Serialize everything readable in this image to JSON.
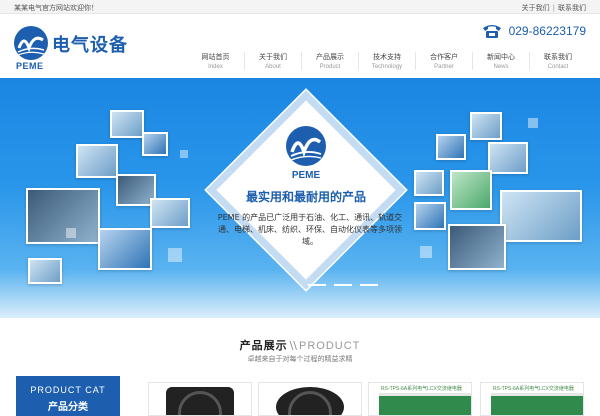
{
  "topbar": {
    "welcome": "某某电气官方网站欢迎你！",
    "links": [
      "关于我们",
      "联系我们"
    ]
  },
  "brand": {
    "name_cn": "电气设备",
    "name_en": "PEME",
    "color": "#1d5fae"
  },
  "contact": {
    "phone": "029-86223179",
    "icon": "telephone-icon"
  },
  "nav": [
    {
      "cn": "网站首页",
      "en": "Index"
    },
    {
      "cn": "关于我们",
      "en": "About"
    },
    {
      "cn": "产品展示",
      "en": "Product"
    },
    {
      "cn": "技术支持",
      "en": "Technology"
    },
    {
      "cn": "合作客户",
      "en": "Partner"
    },
    {
      "cn": "新闻中心",
      "en": "News"
    },
    {
      "cn": "联系我们",
      "en": "Contact"
    }
  ],
  "banner": {
    "logo_text": "PEME",
    "slogan": "最实用和最耐用的产品",
    "description": "PEME 的产品已广泛用于石油、化工、通讯、轨道交通、电梯、机床、纺织、环保、自动化仪表等多项领域。",
    "slide_count": 3,
    "active_slide": 1
  },
  "products": {
    "title_cn": "产品展示",
    "divider": "\\\\",
    "title_en": "PRODUCT",
    "subtitle": "卓越来自于对每个过程的精益求精",
    "category_en": "PRODUCT CAT",
    "category_cn": "产品分类",
    "items": [
      {
        "type": "fan"
      },
      {
        "type": "fan"
      },
      {
        "type": "board",
        "label": "RS-TPS-6A系列电气LCX交流继电器"
      },
      {
        "type": "board",
        "label": "RS-TPS-6A系列电气LCX交流继电器"
      }
    ]
  }
}
